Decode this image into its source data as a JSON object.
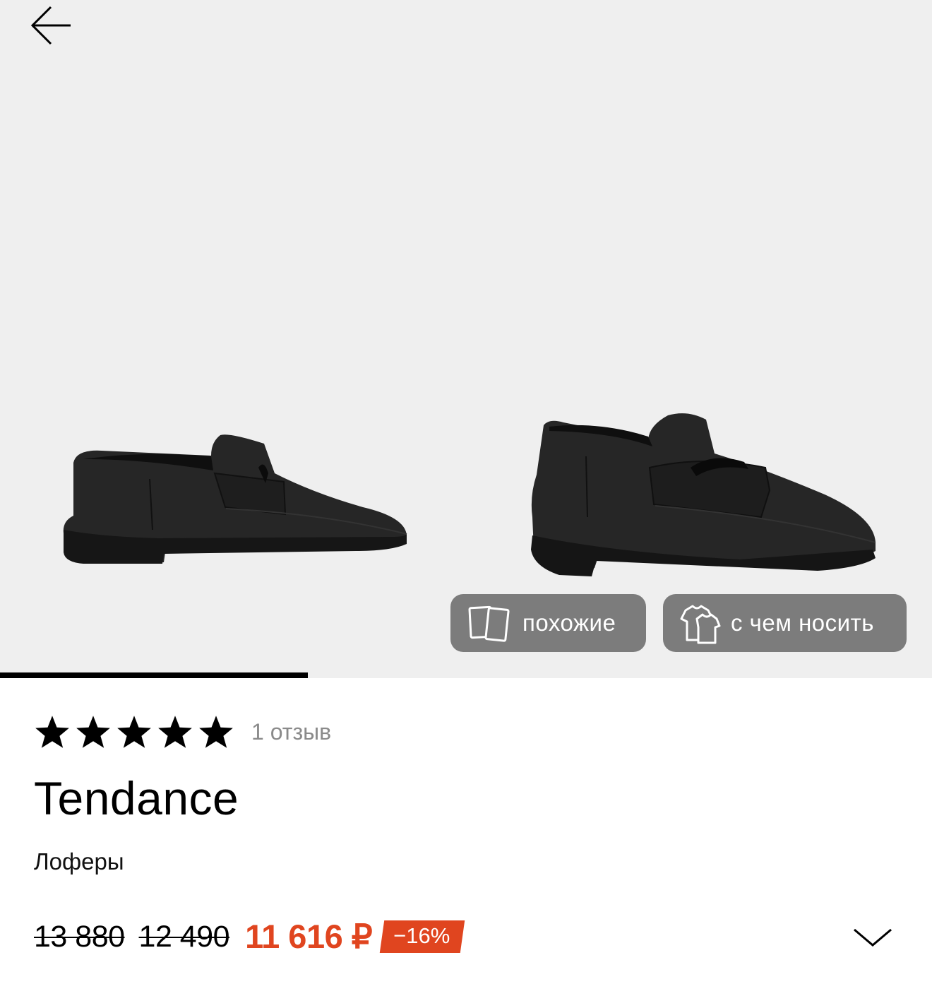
{
  "gallery": {
    "back_icon": "arrow-left-icon",
    "progress_fraction": 0.33,
    "actions": [
      {
        "label": "похожие",
        "icon": "similar-cards-icon"
      },
      {
        "label": "с чем носить",
        "icon": "outfit-clothes-icon"
      }
    ]
  },
  "product": {
    "rating": 5,
    "rating_max": 5,
    "reviews_label": "1 отзыв",
    "brand": "Tendance",
    "category": "Лоферы",
    "prices": {
      "old_1": "13 880",
      "old_2": "12 490",
      "current": "11 616 ₽",
      "discount": "−16%"
    },
    "expand_icon": "chevron-down-icon"
  },
  "colors": {
    "accent": "#e0451f",
    "gallery_bg": "#efefef",
    "pill_bg": "#7c7c7c"
  }
}
